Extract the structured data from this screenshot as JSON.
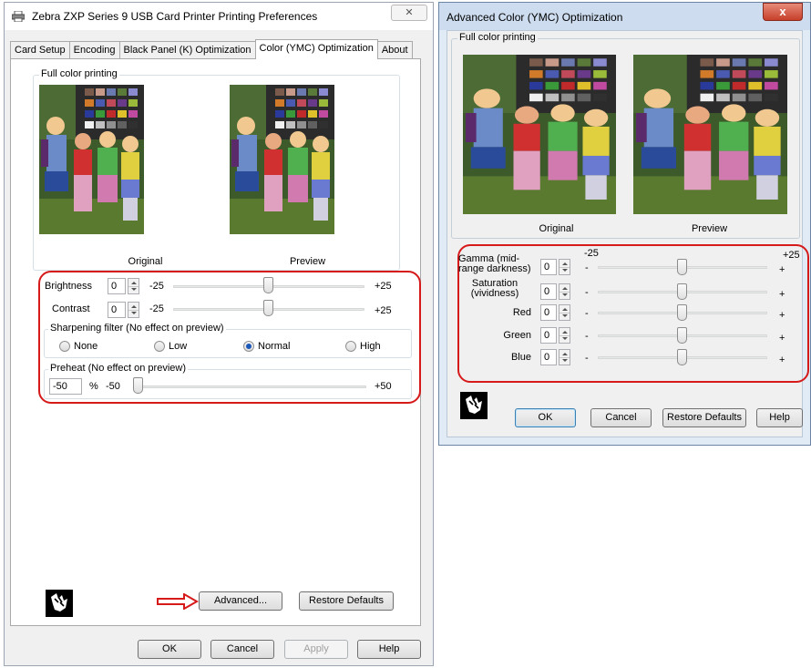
{
  "window1": {
    "title": "Zebra ZXP Series 9 USB Card Printer Printing Preferences",
    "close_glyph": "✕",
    "tabs": [
      {
        "label": "Card Setup"
      },
      {
        "label": "Encoding"
      },
      {
        "label": "Black Panel (K) Optimization"
      },
      {
        "label": "Color (YMC) Optimization",
        "active": true
      },
      {
        "label": "About"
      }
    ],
    "group_full_color": "Full color printing",
    "caption_original": "Original",
    "caption_preview": "Preview",
    "brightness": {
      "label": "Brightness",
      "value": "0",
      "min": "-25",
      "max": "+25",
      "level": 0
    },
    "contrast": {
      "label": "Contrast",
      "value": "0",
      "min": "-25",
      "max": "+25",
      "level": 0
    },
    "sharpening": {
      "label": "Sharpening filter (No effect on preview)",
      "options": [
        {
          "label": "None",
          "selected": false
        },
        {
          "label": "Low",
          "selected": false
        },
        {
          "label": "Normal",
          "selected": true
        },
        {
          "label": "High",
          "selected": false
        }
      ]
    },
    "preheat": {
      "label": "Preheat (No effect on preview)",
      "value": "-50",
      "unit": "%",
      "min": "-50",
      "max": "+50",
      "level": -50
    },
    "buttons": {
      "advanced": "Advanced...",
      "restore_defaults": "Restore Defaults",
      "ok": "OK",
      "cancel": "Cancel",
      "apply": "Apply",
      "help": "Help"
    }
  },
  "window2": {
    "title": "Advanced Color (YMC) Optimization",
    "close_glyph": "x",
    "group_full_color": "Full color printing",
    "caption_original": "Original",
    "caption_preview": "Preview",
    "range_min": "-25",
    "range_max": "+25",
    "minus": "-",
    "plus": "+",
    "sliders": [
      {
        "label": "Gamma (mid-\nrange darkness)",
        "value": "0",
        "level": 0
      },
      {
        "label": "Saturation\n(vividness)",
        "value": "0",
        "level": 0
      },
      {
        "label": "Red",
        "value": "0",
        "level": 0
      },
      {
        "label": "Green",
        "value": "0",
        "level": 0
      },
      {
        "label": "Blue",
        "value": "0",
        "level": 0
      }
    ],
    "buttons": {
      "ok": "OK",
      "cancel": "Cancel",
      "restore_defaults": "Restore Defaults",
      "help": "Help"
    }
  },
  "colors": {
    "highlight_red": "#d61a1a",
    "radio_selected": "#1a57b8"
  },
  "icons": [
    "printer-icon",
    "close-icon",
    "zebra-logo-icon",
    "red-arrow-icon"
  ]
}
